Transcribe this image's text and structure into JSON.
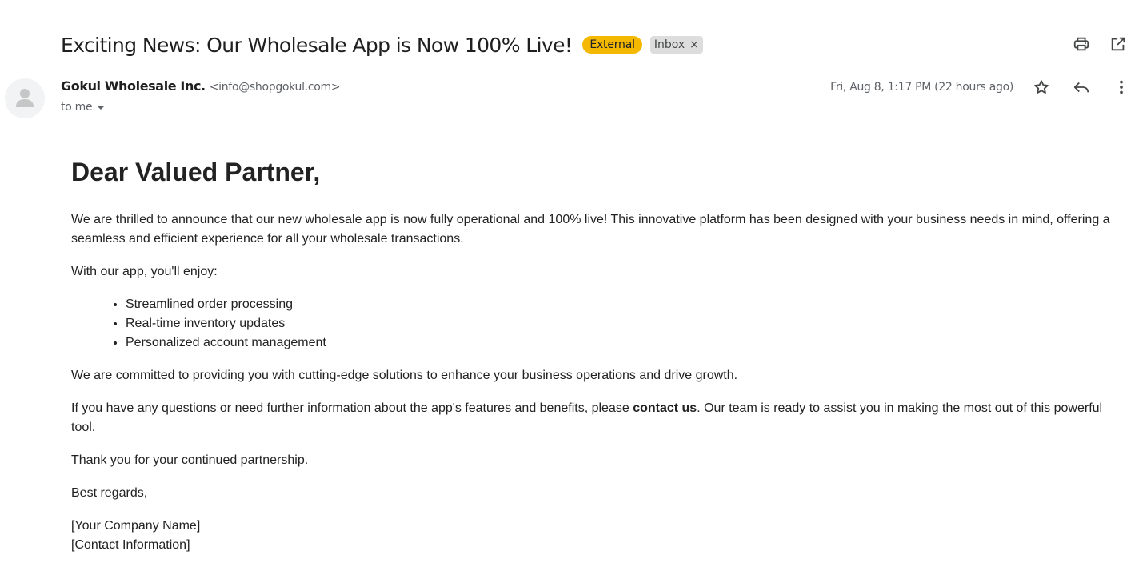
{
  "header": {
    "subject": "Exciting News: Our Wholesale App is Now 100% Live!",
    "labels": {
      "external": "External",
      "inbox": "Inbox",
      "inbox_remove": "×"
    }
  },
  "sender": {
    "name": "Gokul Wholesale Inc.",
    "email": "<info@shopgokul.com>",
    "to": "to me",
    "date": "Fri, Aug 8, 1:17 PM (22 hours ago)"
  },
  "icons": {
    "top": [
      "print-icon",
      "open-in-new-window-icon"
    ],
    "meta": [
      "star-icon",
      "reply-icon",
      "more-vert-icon"
    ],
    "avatar": "person-icon"
  },
  "colors": {
    "external_label": "#f5b800",
    "inbox_label": "#dddddd"
  },
  "message": {
    "greeting": "Dear Valued Partner,",
    "para1": "We are thrilled to announce that our new wholesale app is now fully operational and 100% live! This innovative platform has been designed with your business needs in mind, offering a seamless and efficient experience for all your wholesale transactions.",
    "para2": "With our app, you'll enjoy:",
    "bullets": [
      "Streamlined order processing",
      "Real-time inventory updates",
      "Personalized account management"
    ],
    "para3": "We are committed to providing you with cutting-edge solutions to enhance your business operations and drive growth.",
    "para4_before": "If you have any questions or need further information about the app's features and benefits, please ",
    "para4_link": "contact us",
    "para4_after": ". Our team is ready to assist you in making the most out of this powerful tool.",
    "para5": "Thank you for your continued partnership.",
    "closing": "Best regards,",
    "sig_company": "[Your Company Name]",
    "sig_contact": "[Contact Information]"
  }
}
